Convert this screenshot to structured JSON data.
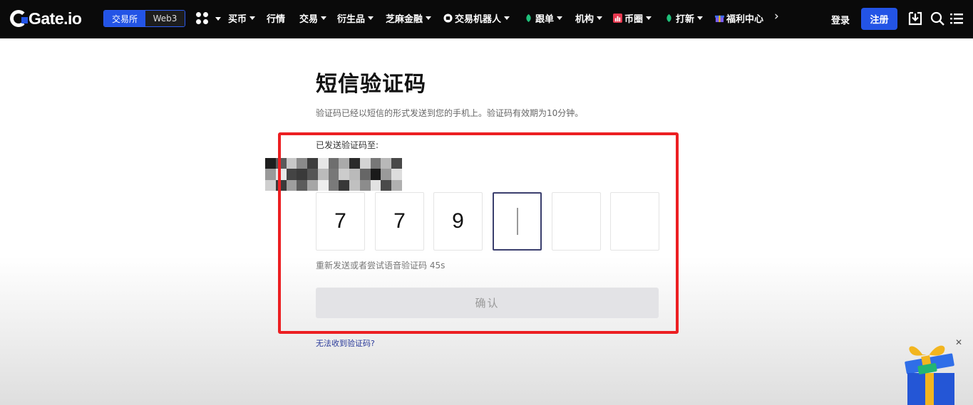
{
  "nav": {
    "logo_text": "Gate.io",
    "exchange_label": "交易所",
    "web3_label": "Web3",
    "items": [
      {
        "label": "买币",
        "dropdown": true
      },
      {
        "label": "行情",
        "dropdown": false
      },
      {
        "label": "交易",
        "dropdown": true
      },
      {
        "label": "衍生品",
        "dropdown": true
      },
      {
        "label": "芝麻金融",
        "dropdown": true
      },
      {
        "label": "交易机器人",
        "dropdown": true,
        "icon": "robot-icon"
      },
      {
        "label": "跟单",
        "dropdown": true,
        "icon": "leaf-icon"
      },
      {
        "label": "机构",
        "dropdown": true
      },
      {
        "label": "币圈",
        "dropdown": true,
        "icon": "chart-icon"
      },
      {
        "label": "打新",
        "dropdown": true,
        "icon": "leaf-icon"
      },
      {
        "label": "福利中心",
        "dropdown": false,
        "icon": "gift-small-icon"
      }
    ],
    "more_glyph": "›",
    "login_label": "登录",
    "register_label": "注册"
  },
  "form": {
    "title": "短信验证码",
    "subtitle": "验证码已经以短信的形式发送到您的手机上。验证码有效期为10分钟。",
    "sent_to_label": "已发送验证码至:",
    "code_digits": [
      "7",
      "7",
      "9",
      "",
      "",
      ""
    ],
    "resend_text": "重新发送或者尝试语音验证码 45s",
    "confirm_label": "确认",
    "help_link": "无法收到验证码?"
  },
  "colors": {
    "brand_blue": "#2354e6",
    "nav_bg": "#0a0a0a",
    "highlight_red": "#ec1f22",
    "active_box_border": "#3b3f6e"
  }
}
